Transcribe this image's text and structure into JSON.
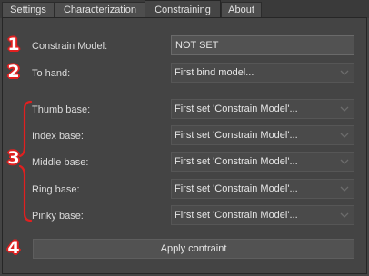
{
  "tabs": [
    {
      "label": "Settings"
    },
    {
      "label": "Characterization"
    },
    {
      "label": "Constraining"
    },
    {
      "label": "About"
    }
  ],
  "active_tab": "Constraining",
  "constrain_model": {
    "label": "Constrain Model:",
    "value": "NOT SET"
  },
  "to_hand": {
    "label": "To hand:",
    "value": "First bind model..."
  },
  "bases": [
    {
      "label": "Thumb base:",
      "value": "First set 'Constrain Model'..."
    },
    {
      "label": "Index base:",
      "value": "First set 'Constrain Model'..."
    },
    {
      "label": "Middle base:",
      "value": "First set 'Constrain Model'..."
    },
    {
      "label": "Ring base:",
      "value": "First set 'Constrain Model'..."
    },
    {
      "label": "Pinky base:",
      "value": "First set 'Constrain Model'..."
    }
  ],
  "apply_button": {
    "label": "Apply contraint"
  },
  "annotations": [
    "1",
    "2",
    "3",
    "4"
  ],
  "colors": {
    "annotation": "#e02020",
    "background": "#444444",
    "field": "#525252"
  },
  "icons": {
    "dropdown": "chevron-down-icon"
  }
}
